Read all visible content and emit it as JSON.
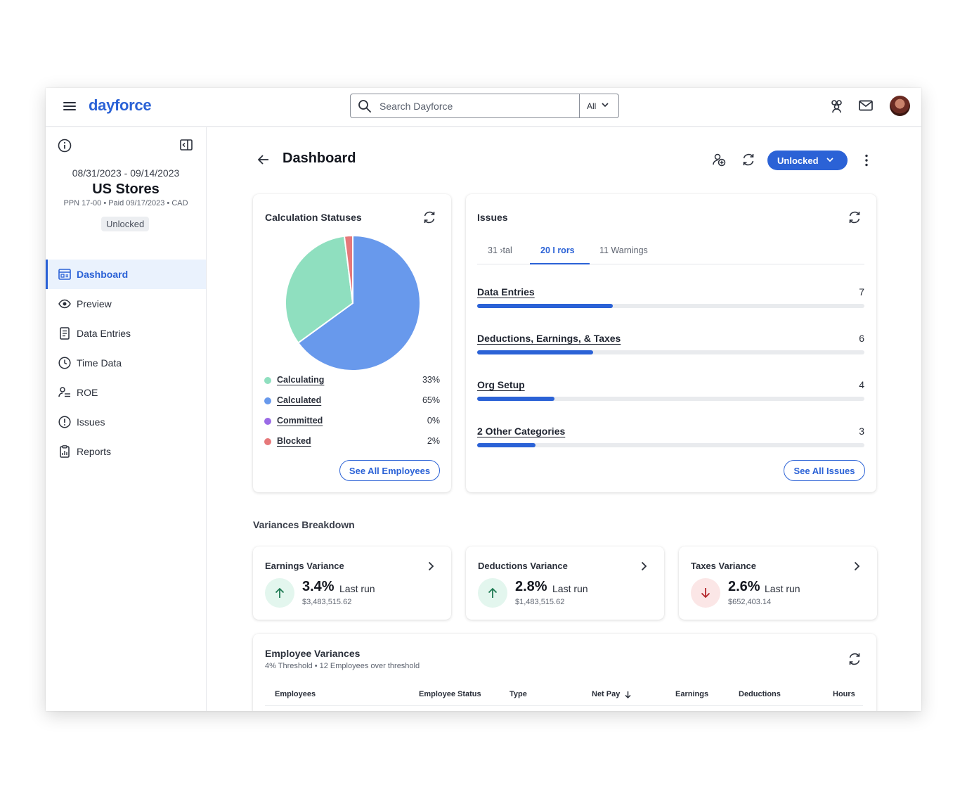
{
  "app": {
    "logo": "dayforce"
  },
  "search": {
    "placeholder": "Search Dayforce",
    "scope": "All"
  },
  "sidebar": {
    "dates": "08/31/2023 - 09/14/2023",
    "title": "US Stores",
    "meta": "PPN 17-00 • Paid 09/17/2023 • CAD",
    "status": "Unlocked",
    "items": [
      {
        "label": "Dashboard",
        "icon": "dashboard-icon",
        "active": true
      },
      {
        "label": "Preview",
        "icon": "eye-icon"
      },
      {
        "label": "Data Entries",
        "icon": "document-icon"
      },
      {
        "label": "Time Data",
        "icon": "clock-icon"
      },
      {
        "label": "ROE",
        "icon": "person-list-icon"
      },
      {
        "label": "Issues",
        "icon": "alert-circle-icon"
      },
      {
        "label": "Reports",
        "icon": "report-icon"
      }
    ]
  },
  "header": {
    "title": "Dashboard",
    "status_button": "Unlocked"
  },
  "calc_statuses": {
    "title": "Calculation Statuses",
    "button": "See All Employees",
    "legend": [
      {
        "label": "Calculating",
        "value": "33%",
        "color": "#8fdfbf"
      },
      {
        "label": "Calculated",
        "value": "65%",
        "color": "#6899ec"
      },
      {
        "label": "Committed",
        "value": "0%",
        "color": "#9b6be6"
      },
      {
        "label": "Blocked",
        "value": "2%",
        "color": "#e6787a"
      }
    ]
  },
  "chart_data": {
    "type": "pie",
    "categories": [
      "Calculating",
      "Calculated",
      "Committed",
      "Blocked"
    ],
    "values": [
      33,
      65,
      0,
      2
    ],
    "colors": [
      "#8fdfbf",
      "#6899ec",
      "#9b6be6",
      "#e6787a"
    ]
  },
  "issues": {
    "title": "Issues",
    "tabs": [
      "31 ›tal",
      "20 I rors",
      "11 Warnings"
    ],
    "rows": [
      {
        "name": "Data Entries",
        "count": "7",
        "fraction": 0.35
      },
      {
        "name": "Deductions, Earnings, & Taxes",
        "count": "6",
        "fraction": 0.3
      },
      {
        "name": "Org Setup",
        "count": "4",
        "fraction": 0.2
      },
      {
        "name": "2 Other Categories",
        "count": "3",
        "fraction": 0.15
      }
    ],
    "button": "See All Issues"
  },
  "variances": {
    "section_title": "Variances Breakdown",
    "cards": [
      {
        "title": "Earnings Variance",
        "pct": "3.4%",
        "label": "Last run",
        "amount": "$3,483,515.62",
        "direction": "up"
      },
      {
        "title": "Deductions Variance",
        "pct": "2.8%",
        "label": "Last run",
        "amount": "$1,483,515.62",
        "direction": "up"
      },
      {
        "title": "Taxes Variance",
        "pct": "2.6%",
        "label": "Last run",
        "amount": "$652,403.14",
        "direction": "down"
      }
    ]
  },
  "employee_variances": {
    "title": "Employee Variances",
    "subtitle": "4% Threshold • 12 Employees over threshold",
    "columns": [
      "Employees",
      "Employee Status",
      "Type",
      "Net Pay",
      "Earnings",
      "Deductions",
      "Hours"
    ]
  }
}
